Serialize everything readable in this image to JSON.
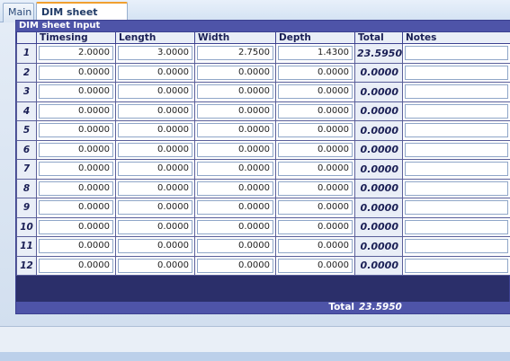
{
  "tabs": [
    {
      "label": "Main"
    },
    {
      "label": "DIM sheet input"
    }
  ],
  "grid": {
    "title": "DIM sheet Input",
    "columns": [
      "",
      "Timesing",
      "Length",
      "Width",
      "Depth",
      "Total",
      "Notes"
    ],
    "rows": [
      {
        "n": "1",
        "timesing": "2.0000",
        "length": "3.0000",
        "width": "2.7500",
        "depth": "1.4300",
        "total": "23.5950",
        "notes": ""
      },
      {
        "n": "2",
        "timesing": "0.0000",
        "length": "0.0000",
        "width": "0.0000",
        "depth": "0.0000",
        "total": "0.0000",
        "notes": ""
      },
      {
        "n": "3",
        "timesing": "0.0000",
        "length": "0.0000",
        "width": "0.0000",
        "depth": "0.0000",
        "total": "0.0000",
        "notes": ""
      },
      {
        "n": "4",
        "timesing": "0.0000",
        "length": "0.0000",
        "width": "0.0000",
        "depth": "0.0000",
        "total": "0.0000",
        "notes": ""
      },
      {
        "n": "5",
        "timesing": "0.0000",
        "length": "0.0000",
        "width": "0.0000",
        "depth": "0.0000",
        "total": "0.0000",
        "notes": ""
      },
      {
        "n": "6",
        "timesing": "0.0000",
        "length": "0.0000",
        "width": "0.0000",
        "depth": "0.0000",
        "total": "0.0000",
        "notes": ""
      },
      {
        "n": "7",
        "timesing": "0.0000",
        "length": "0.0000",
        "width": "0.0000",
        "depth": "0.0000",
        "total": "0.0000",
        "notes": ""
      },
      {
        "n": "8",
        "timesing": "0.0000",
        "length": "0.0000",
        "width": "0.0000",
        "depth": "0.0000",
        "total": "0.0000",
        "notes": ""
      },
      {
        "n": "9",
        "timesing": "0.0000",
        "length": "0.0000",
        "width": "0.0000",
        "depth": "0.0000",
        "total": "0.0000",
        "notes": ""
      },
      {
        "n": "10",
        "timesing": "0.0000",
        "length": "0.0000",
        "width": "0.0000",
        "depth": "0.0000",
        "total": "0.0000",
        "notes": ""
      },
      {
        "n": "11",
        "timesing": "0.0000",
        "length": "0.0000",
        "width": "0.0000",
        "depth": "0.0000",
        "total": "0.0000",
        "notes": ""
      },
      {
        "n": "12",
        "timesing": "0.0000",
        "length": "0.0000",
        "width": "0.0000",
        "depth": "0.0000",
        "total": "0.0000",
        "notes": ""
      }
    ],
    "footer": {
      "label": "Total",
      "value": "23.5950"
    }
  },
  "colors": {
    "header_bar": "#4e54a8",
    "active_tab_accent": "#f0a030"
  }
}
